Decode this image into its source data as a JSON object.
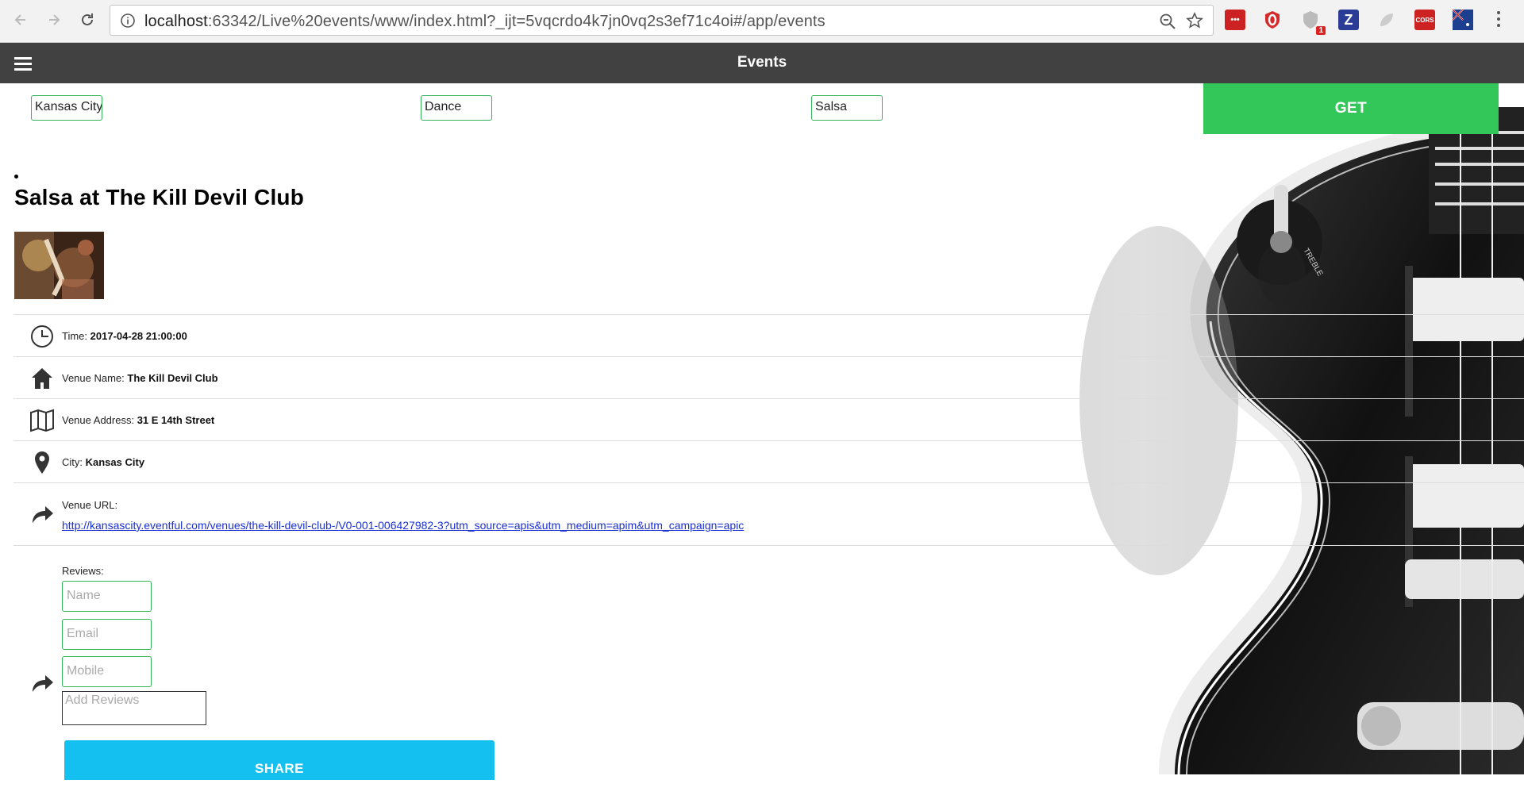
{
  "browser": {
    "url_host": "localhost",
    "url_path": ":63342/Live%20events/www/index.html?_ijt=5vqcrdo4k7jn0vq2s3ef71c4oi#/app/events",
    "extensions": [
      {
        "name": "ext-lastpass-icon",
        "label": "•••",
        "color": "#cc2222"
      },
      {
        "name": "ext-opera-icon",
        "label": "",
        "color": "#d42a2a"
      },
      {
        "name": "ext-shield-icon",
        "label": "1",
        "color": "#999999"
      },
      {
        "name": "ext-z-icon",
        "label": "Z",
        "color": "#2b3c96"
      },
      {
        "name": "ext-leaf-icon",
        "label": "",
        "color": "#c8c8c8"
      },
      {
        "name": "ext-cors-icon",
        "label": "CORS",
        "color": "#cc2222"
      },
      {
        "name": "ext-flag-icon",
        "label": "",
        "color": "#1c3f8f"
      }
    ]
  },
  "app": {
    "title": "Events"
  },
  "filters": {
    "location": "Kansas City",
    "category": "Dance",
    "keyword": "Salsa",
    "get_label": "GET"
  },
  "event": {
    "title": "Salsa at The Kill Devil Club",
    "time_label": "Time:",
    "time_value": "2017-04-28 21:00:00",
    "venue_name_label": "Venue Name:",
    "venue_name_value": "The Kill Devil Club",
    "venue_address_label": "Venue Address:",
    "venue_address_value": "31 E 14th Street",
    "city_label": "City:",
    "city_value": "Kansas City",
    "venue_url_label": "Venue URL:",
    "venue_url_value": "http://kansascity.eventful.com/venues/the-kill-devil-club-/V0-001-006427982-3?utm_source=apis&utm_medium=apim&utm_campaign=apic"
  },
  "reviews": {
    "label": "Reviews:",
    "name_placeholder": "Name",
    "email_placeholder": "Email",
    "mobile_placeholder": "Mobile",
    "reviews_placeholder": "Add Reviews",
    "share_label": "SHARE"
  }
}
